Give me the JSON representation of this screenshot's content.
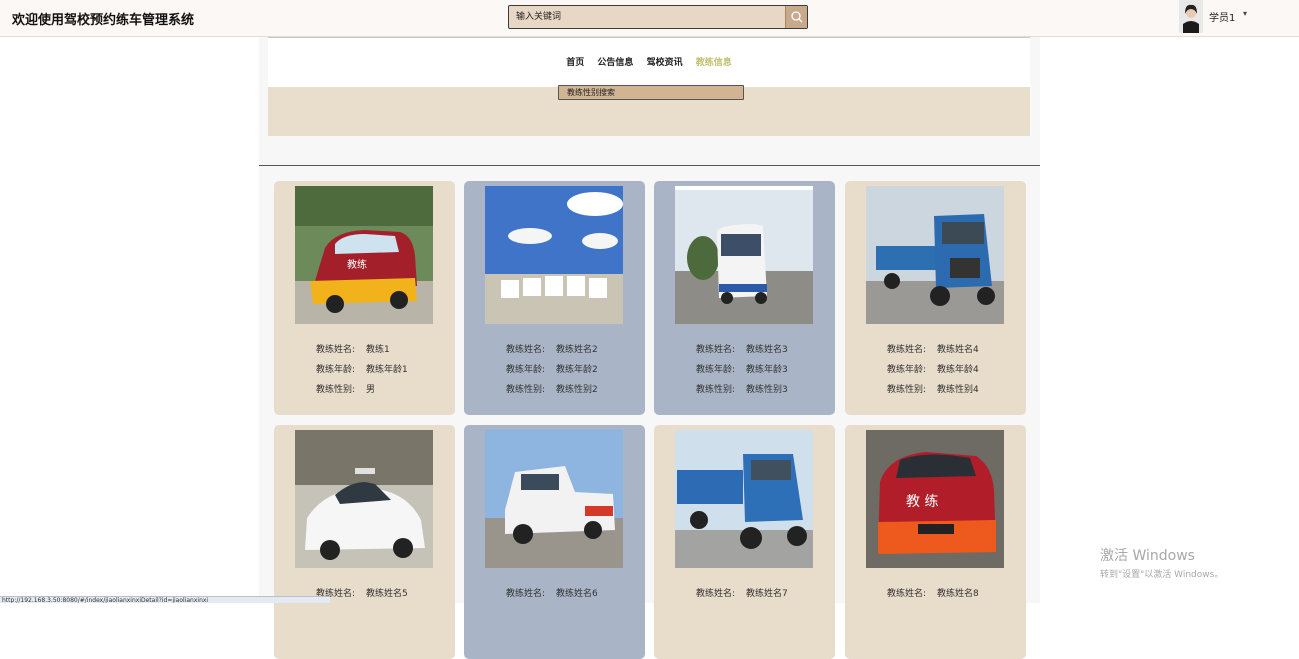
{
  "header": {
    "title": "欢迎使用驾校预约练车管理系统",
    "search_placeholder": "输入关键词",
    "user_name": "学员1",
    "user_caret": "▾"
  },
  "nav": {
    "items": [
      "首页",
      "公告信息",
      "驾校资讯",
      "教练信息"
    ],
    "active_index": 3
  },
  "filter": {
    "label": "教练性别搜索"
  },
  "labels": {
    "name": "教练姓名:",
    "age": "教练年龄:",
    "gender": "教练性别:"
  },
  "coaches": [
    {
      "name": "教练1",
      "age": "教练年龄1",
      "gender": "男",
      "card_color": "beige",
      "vehicle": "van-red-yellow"
    },
    {
      "name": "教练姓名2",
      "age": "教练年龄2",
      "gender": "教练性别2",
      "card_color": "blue",
      "vehicle": "fleet"
    },
    {
      "name": "教练姓名3",
      "age": "教练年龄3",
      "gender": "教练性别3",
      "card_color": "blue",
      "vehicle": "bus"
    },
    {
      "name": "教练姓名4",
      "age": "教练年龄4",
      "gender": "教练性别4",
      "card_color": "beige",
      "vehicle": "truck-blue"
    },
    {
      "name": "教练姓名5",
      "card_color": "beige",
      "vehicle": "sedan-white"
    },
    {
      "name": "教练姓名6",
      "card_color": "blue",
      "vehicle": "pickup"
    },
    {
      "name": "教练姓名7",
      "card_color": "beige",
      "vehicle": "truck-blue-2"
    },
    {
      "name": "教练姓名8",
      "card_color": "beige",
      "vehicle": "van-red-orange"
    }
  ],
  "status_url": "http://192.168.3.50:8080/#/index/jiaolianxinxiDetail?id=jiaolianxinxi",
  "watermark": {
    "line1": "激活 Windows",
    "line2": "转到\"设置\"以激活 Windows。"
  },
  "colors": {
    "card_beige": "#e8dcca",
    "card_blue": "#a9b5c6",
    "nav_active": "#c2c06f",
    "search_bg": "#e8d7c5"
  }
}
